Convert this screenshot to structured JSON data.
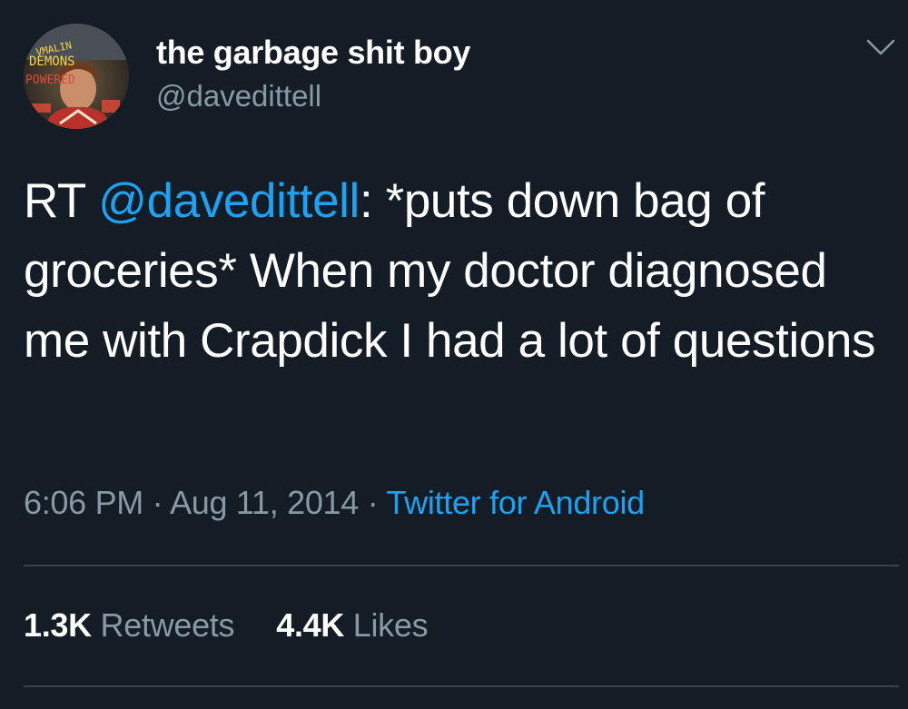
{
  "user": {
    "display_name": "the garbage shit boy",
    "handle": "@davedittell",
    "avatar_text": "VMALIN DEMONS POWERED"
  },
  "tweet": {
    "prefix": "RT ",
    "mention": "@davedittell",
    "body": ": *puts down bag of groceries* When my doctor diagnosed me with Crapdick I had a lot of questions"
  },
  "meta": {
    "time": "6:06 PM",
    "separator1": " · ",
    "date": "Aug 11, 2014",
    "separator2": " · ",
    "source": "Twitter for Android"
  },
  "stats": {
    "retweets_count": "1.3K",
    "retweets_label": "Retweets",
    "likes_count": "4.4K",
    "likes_label": "Likes"
  },
  "icons": {
    "menu": "chevron-down-icon"
  },
  "colors": {
    "background": "#141d26",
    "text": "#ffffff",
    "secondary": "#8899a6",
    "link": "#1da1f2",
    "divider": "#38444d"
  }
}
